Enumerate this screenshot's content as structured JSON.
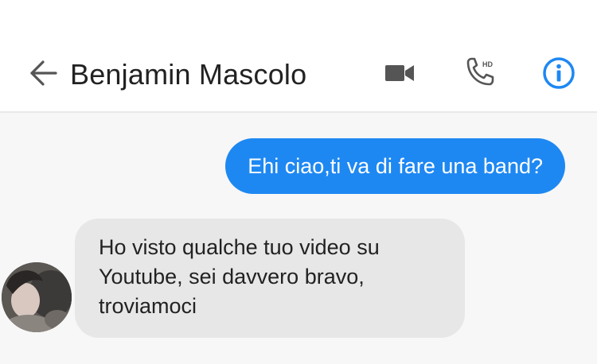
{
  "header": {
    "back_icon": "arrow-left-icon",
    "contact_name": "Benjamin Mascolo",
    "video_icon": "video-camera-icon",
    "call_icon": "hd-phone-icon",
    "call_badge": "HD",
    "info_icon": "info-icon"
  },
  "messages": [
    {
      "direction": "outgoing",
      "text": "Ehi ciao,ti va di fare una band?"
    },
    {
      "direction": "incoming",
      "text": "Ho visto qualche tuo video su Youtube, sei davvero bravo, troviamoci"
    }
  ],
  "colors": {
    "accent": "#1e88f2",
    "incoming_bubble": "#e7e7e7",
    "thread_background": "#f7f7f7"
  }
}
